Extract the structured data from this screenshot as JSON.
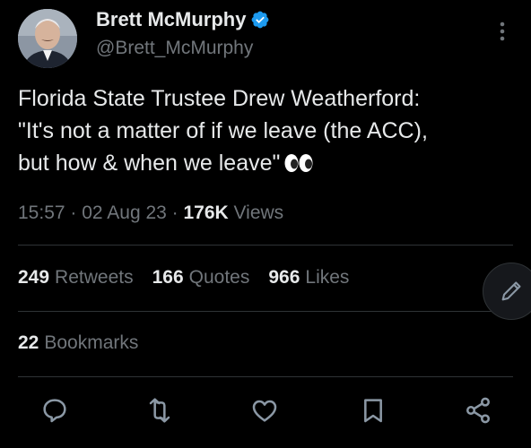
{
  "author": {
    "display_name": "Brett McMurphy",
    "handle": "@Brett_McMurphy",
    "verified": true,
    "verified_color": "#1d9bf0"
  },
  "tweet": {
    "line1": "Florida State Trustee Drew Weatherford:",
    "line2": "\"It's not a matter of if we leave (the ACC),",
    "line3": "but how & when we leave\"",
    "emoji": "eyes"
  },
  "meta": {
    "time": "15:57",
    "sep1": " · ",
    "date": "02 Aug 23",
    "sep2": " · ",
    "views_count": "176K",
    "views_label": " Views"
  },
  "stats": {
    "retweets": {
      "count": "249",
      "label": "Retweets"
    },
    "quotes": {
      "count": "166",
      "label": "Quotes"
    },
    "likes": {
      "count": "966",
      "label": "Likes"
    },
    "bookmarks": {
      "count": "22",
      "label": "Bookmarks"
    }
  },
  "icons": {
    "more": "more-vertical-icon",
    "compose": "pen-icon",
    "reply": "reply-icon",
    "retweet": "retweet-icon",
    "like": "heart-icon",
    "bookmark": "bookmark-icon",
    "share": "share-icon"
  },
  "colors": {
    "background": "#000000",
    "text": "#e7e9ea",
    "secondary": "#71767b",
    "divider": "#2f3336"
  }
}
